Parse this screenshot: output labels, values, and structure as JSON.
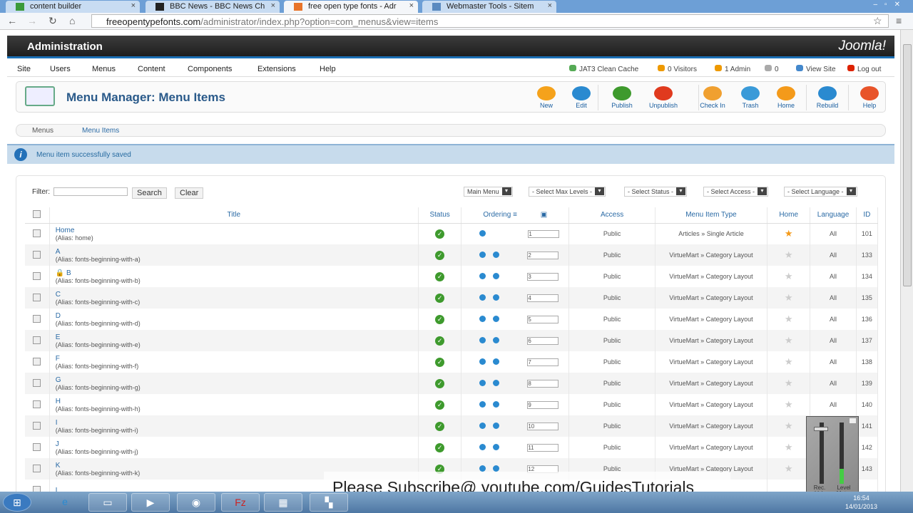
{
  "browser": {
    "tabs": [
      {
        "label": "content builder",
        "active": false
      },
      {
        "label": "BBC News - BBC News Ch",
        "active": false
      },
      {
        "label": "free open type fonts - Adr",
        "active": true
      },
      {
        "label": "Webmaster Tools - Sitem",
        "active": false
      }
    ],
    "url_domain": "freeopentypefonts.com",
    "url_path": "/administrator/index.php?option=com_menus&view=items"
  },
  "header": {
    "title": "Administration",
    "logo": "Joomla!"
  },
  "menu": [
    "Site",
    "Users",
    "Menus",
    "Content",
    "Components",
    "Extensions",
    "Help"
  ],
  "status": {
    "cache": "JAT3 Clean Cache",
    "visitors": "0 Visitors",
    "admin": "1 Admin",
    "messages": "0",
    "view_site": "View Site",
    "logout": "Log out"
  },
  "page_title": "Menu Manager: Menu Items",
  "toolbar": [
    {
      "label": "New",
      "color": "#f5a21b"
    },
    {
      "label": "Edit",
      "color": "#2a8ad0"
    },
    {
      "label": "Publish",
      "color": "#3e9a2d"
    },
    {
      "label": "Unpublish",
      "color": "#e03a1e"
    },
    {
      "label": "Check In",
      "color": "#f0a030"
    },
    {
      "label": "Trash",
      "color": "#3a9ad8"
    },
    {
      "label": "Home",
      "color": "#f49a1a"
    },
    {
      "label": "Rebuild",
      "color": "#2a8ad0"
    },
    {
      "label": "Help",
      "color": "#e8542a"
    }
  ],
  "submenu": [
    "Menus",
    "Menu Items"
  ],
  "message": "Menu item successfully saved",
  "filter": {
    "label": "Filter:",
    "value": "",
    "search": "Search",
    "clear": "Clear"
  },
  "selects": [
    "Main Menu",
    "- Select Max Levels -",
    "- Select Status -",
    "- Select Access -",
    "- Select Language -"
  ],
  "columns": [
    "Title",
    "Status",
    "Ordering",
    "Access",
    "Menu Item Type",
    "Home",
    "Language",
    "ID"
  ],
  "rows": [
    {
      "title": "Home",
      "alias": "(Alias: home)",
      "order": "1",
      "access": "Public",
      "type": "Articles » Single Article",
      "home": true,
      "lang": "All",
      "id": "101"
    },
    {
      "title": "A",
      "alias": "(Alias: fonts-beginning-with-a)",
      "order": "2",
      "access": "Public",
      "type": "VirtueMart » Category Layout",
      "home": false,
      "lang": "All",
      "id": "133"
    },
    {
      "title": "B",
      "alias": "(Alias: fonts-beginning-with-b)",
      "order": "3",
      "access": "Public",
      "type": "VirtueMart » Category Layout",
      "home": false,
      "lang": "All",
      "id": "134",
      "locked": true
    },
    {
      "title": "C",
      "alias": "(Alias: fonts-beginning-with-c)",
      "order": "4",
      "access": "Public",
      "type": "VirtueMart » Category Layout",
      "home": false,
      "lang": "All",
      "id": "135"
    },
    {
      "title": "D",
      "alias": "(Alias: fonts-beginning-with-d)",
      "order": "5",
      "access": "Public",
      "type": "VirtueMart » Category Layout",
      "home": false,
      "lang": "All",
      "id": "136"
    },
    {
      "title": "E",
      "alias": "(Alias: fonts-beginning-with-e)",
      "order": "6",
      "access": "Public",
      "type": "VirtueMart » Category Layout",
      "home": false,
      "lang": "All",
      "id": "137"
    },
    {
      "title": "F",
      "alias": "(Alias: fonts-beginning-with-f)",
      "order": "7",
      "access": "Public",
      "type": "VirtueMart » Category Layout",
      "home": false,
      "lang": "All",
      "id": "138"
    },
    {
      "title": "G",
      "alias": "(Alias: fonts-beginning-with-g)",
      "order": "8",
      "access": "Public",
      "type": "VirtueMart » Category Layout",
      "home": false,
      "lang": "All",
      "id": "139"
    },
    {
      "title": "H",
      "alias": "(Alias: fonts-beginning-with-h)",
      "order": "9",
      "access": "Public",
      "type": "VirtueMart » Category Layout",
      "home": false,
      "lang": "All",
      "id": "140"
    },
    {
      "title": "I",
      "alias": "(Alias: fonts-beginning-with-i)",
      "order": "10",
      "access": "Public",
      "type": "VirtueMart » Category Layout",
      "home": false,
      "lang": "All",
      "id": "141"
    },
    {
      "title": "J",
      "alias": "(Alias: fonts-beginning-with-j)",
      "order": "11",
      "access": "Public",
      "type": "VirtueMart » Category Layout",
      "home": false,
      "lang": "All",
      "id": "142"
    },
    {
      "title": "K",
      "alias": "(Alias: fonts-beginning-with-k)",
      "order": "12",
      "access": "Public",
      "type": "VirtueMart » Category Layout",
      "home": false,
      "lang": "All",
      "id": "143"
    },
    {
      "title": "L",
      "alias": "",
      "order": "",
      "access": "",
      "type": "",
      "home": false,
      "lang": "",
      "id": ""
    }
  ],
  "overlay": {
    "banner": "Please Subscribe@ youtube.com/GuidesTutorials",
    "mixer_left": "Rec. Vol.",
    "mixer_right": "Level Meter",
    "level": 0.25
  },
  "taskbar": {
    "time": "16:54",
    "date": "14/01/2013"
  }
}
